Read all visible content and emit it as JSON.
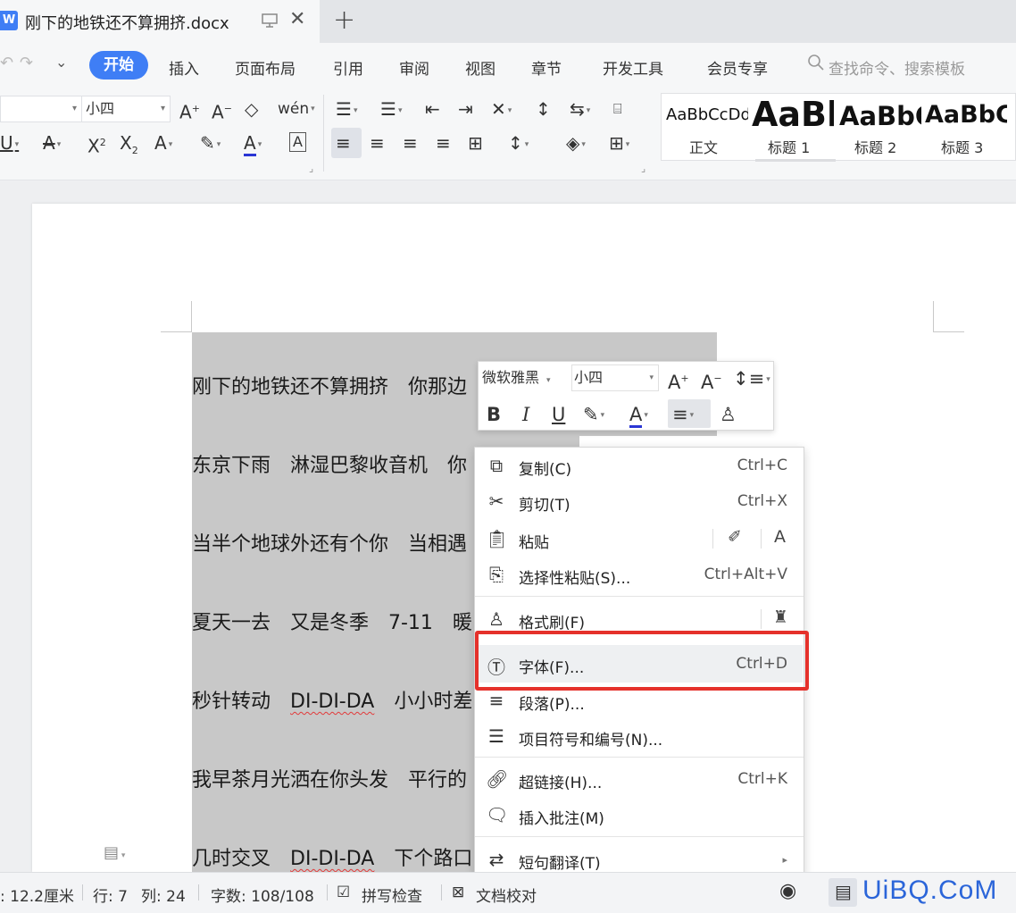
{
  "titlebar": {
    "app_icon": "W",
    "tab_title": "刚下的地铁还不算拥挤.docx",
    "new_tab": "+"
  },
  "menubar": {
    "items": [
      "开始",
      "插入",
      "页面布局",
      "引用",
      "审阅",
      "视图",
      "章节",
      "开发工具",
      "会员专享"
    ],
    "search_placeholder": "查找命令、搜索模板"
  },
  "ribbon": {
    "font_size": "小四",
    "styles": [
      {
        "sample": "AaBbCcDd",
        "label": "正文"
      },
      {
        "sample": "AaBb",
        "label": "标题 1"
      },
      {
        "sample": "AaBbC",
        "label": "标题 2"
      },
      {
        "sample": "AaBbC",
        "label": "标题 3"
      }
    ]
  },
  "document": {
    "lines": [
      "刚下的地铁还不算拥挤　你那边",
      "东京下雨　淋湿巴黎收音机　你",
      "当半个地球外还有个你　当相遇",
      "夏天一去　又是冬季　7-11　暖",
      "秒针转动　DI-DI-DA　小小时差",
      "我早茶月光洒在你头发　平行的",
      "几时交叉　DI-DI-DA　下个路口"
    ]
  },
  "mini_toolbar": {
    "font_name": "微软雅黑",
    "font_size": "小四"
  },
  "context_menu": {
    "items": [
      {
        "label": "复制(C)",
        "shortcut": "Ctrl+C"
      },
      {
        "label": "剪切(T)",
        "shortcut": "Ctrl+X"
      },
      {
        "label": "粘贴",
        "shortcut": ""
      },
      {
        "label": "选择性粘贴(S)...",
        "shortcut": "Ctrl+Alt+V"
      },
      {
        "label": "格式刷(F)",
        "shortcut": ""
      },
      {
        "label": "字体(F)...",
        "shortcut": "Ctrl+D"
      },
      {
        "label": "段落(P)...",
        "shortcut": ""
      },
      {
        "label": "项目符号和编号(N)...",
        "shortcut": ""
      },
      {
        "label": "超链接(H)...",
        "shortcut": "Ctrl+K"
      },
      {
        "label": "插入批注(M)",
        "shortcut": ""
      },
      {
        "label": "短句翻译(T)",
        "shortcut": ""
      }
    ],
    "highlighted": "字体(F)..."
  },
  "statusbar": {
    "position": ": 12.2厘米",
    "row": "行: 7",
    "col": "列: 24",
    "word_count": "字数: 108/108",
    "spell_check": "拼写检查",
    "doc_proof": "文档校对"
  },
  "watermark": "UiBQ.CoM",
  "colors": {
    "accent": "#3f7ef5",
    "highlight_box": "#e5312b",
    "selection": "#c8c8c8"
  }
}
